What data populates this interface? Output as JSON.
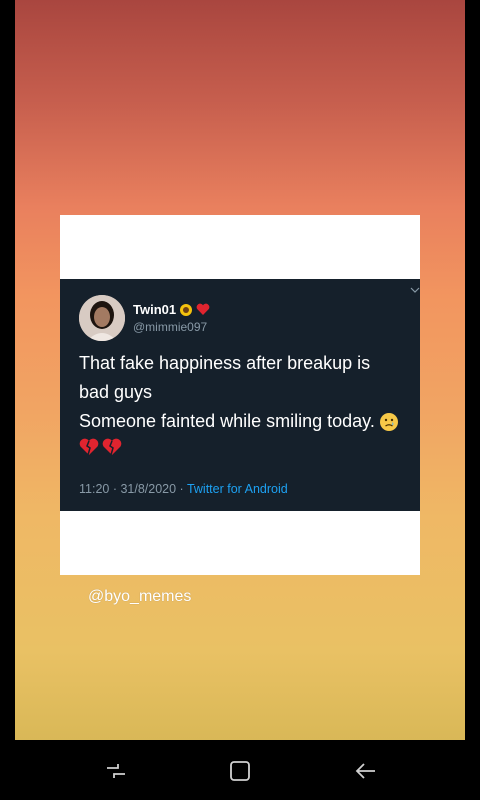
{
  "tweet": {
    "display_name": "Twin01",
    "handle": "@mimmie097",
    "lines": [
      "That fake happiness after breakup is",
      "bad guys",
      "Someone fainted while smiling today."
    ],
    "timestamp": "11:20 · 31/8/2020 · ",
    "source": "Twitter for Android"
  },
  "watermark": "@byo_memes",
  "navbar": {
    "recent_icon": "recent-apps-icon",
    "home_icon": "home-icon",
    "back_icon": "back-icon"
  },
  "colors": {
    "tweet_background": "#15202b",
    "link": "#1da1f2",
    "secondary_text": "#8899a6"
  }
}
